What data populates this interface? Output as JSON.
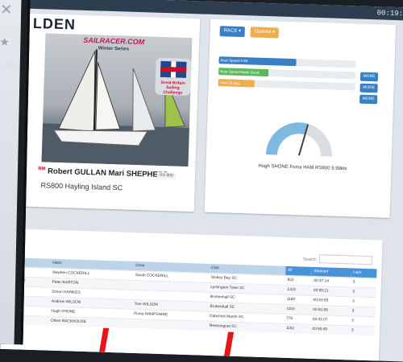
{
  "topbar": {
    "clock": "00:19:5"
  },
  "boat_card": {
    "brand": "LDEN",
    "series_logo": "SAILRACER.COM",
    "series_sub": "Winter Series",
    "flag_caption": "Great Britain Sailing Challenge",
    "names_prefix": "RM",
    "names": "Robert GULLAN Mari SHEPHERD",
    "tag": "RS 800",
    "club": "RS800 Hayling Island SC"
  },
  "speed_card": {
    "btn_race": "RACE ▾",
    "btn_options": "Options ▾",
    "bars": [
      {
        "label": "Boat Speed 9.99",
        "color": "#3a7fc4",
        "fill": 0.55,
        "button": "MORE"
      },
      {
        "label": "Boat Speed Made Good",
        "color": "#5cb85c",
        "fill": 0.35,
        "button": "MORE"
      },
      {
        "label": "Heel 10 deg",
        "color": "#f0ad4e",
        "fill": 0.25,
        "button": "MORE"
      }
    ],
    "gauge_value": 0.58,
    "gauge_caption": "Hugh SHONE Fiona HAM RS800 9.99kts",
    "colors": {
      "gauge_fill": "#7fb8e0",
      "gauge_empty": "#dadee3",
      "needle": "#444444"
    }
  },
  "results_table": {
    "search_label": "Search:",
    "search_value": "",
    "columns": [
      "Class",
      "Helm",
      "Crew",
      "Club",
      "SF",
      "Elapsed",
      "Laps"
    ],
    "rows": [
      [
        "RS400",
        "Stephen COCKERILL",
        "Sarah COCKERILL",
        "Stokes Bay SC",
        "822",
        "00:47:14",
        "3"
      ],
      [
        "RS Aero 7",
        "Peter BARTON",
        "",
        "Lymington Town SC",
        "1315",
        "00:55:21",
        "3"
      ],
      [
        "K1",
        "Simon HAWKES",
        "",
        "Brokenhall SC",
        "1180",
        "00:53:55",
        "3"
      ],
      [
        "Wayfarer",
        "Andrew WILSON",
        "Tom WILSON",
        "Brokenhall SC",
        "1102",
        "00:52:59",
        "3"
      ],
      [
        "RS800",
        "Hugh SHONE",
        "Fiona HAMPSHIRE",
        "Dabchick Marsh SC",
        "770",
        "00:41:07",
        "3"
      ],
      [
        "Phantom",
        "Oliver BACKHOUSE",
        "",
        "Restronguet SC",
        "1152",
        "00:55:45",
        "3"
      ]
    ]
  }
}
